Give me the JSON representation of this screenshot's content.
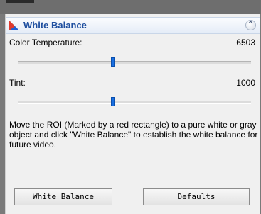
{
  "panel": {
    "title": "White Balance",
    "collapse_icon": "chevrons-up-icon",
    "title_icon": "color-triangle-icon"
  },
  "color_temperature": {
    "label": "Color Temperature:",
    "value": "6503",
    "slider_fraction": 0.41
  },
  "tint": {
    "label": "Tint:",
    "value": "1000",
    "slider_fraction": 0.41
  },
  "description": "Move the ROI (Marked by a red rectangle) to a pure white or gray object and click \"White Balance\" to establish the white balance for future video.",
  "buttons": {
    "white_balance": "White Balance",
    "defaults": "Defaults"
  }
}
